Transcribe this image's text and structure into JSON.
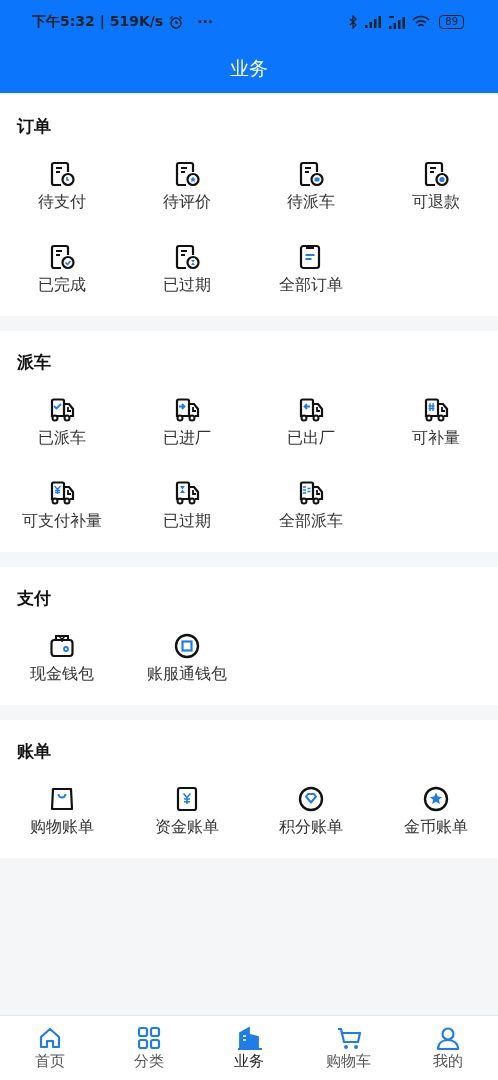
{
  "status_bar": {
    "time": "下午5:32 | 519K/s",
    "more": "···",
    "battery": "89"
  },
  "title": "业务",
  "sections": [
    {
      "title": "订单",
      "kind": "order",
      "items": [
        "待支付",
        "待评价",
        "待派车",
        "可退款",
        "已完成",
        "已过期",
        "全部订单"
      ]
    },
    {
      "title": "派车",
      "kind": "truck",
      "items": [
        "已派车",
        "已进厂",
        "已出厂",
        "可补量",
        "可支付补量",
        "已过期",
        "全部派车"
      ]
    },
    {
      "title": "支付",
      "kind": "wallet",
      "items": [
        "现金钱包",
        "账服通钱包"
      ]
    },
    {
      "title": "账单",
      "kind": "bill",
      "items": [
        "购物账单",
        "资金账单",
        "积分账单",
        "金币账单"
      ]
    }
  ],
  "tab_bar": [
    {
      "label": "首页",
      "selected": false
    },
    {
      "label": "分类",
      "selected": false
    },
    {
      "label": "业务",
      "selected": true
    },
    {
      "label": "购物车",
      "selected": false
    },
    {
      "label": "我的",
      "selected": false
    }
  ]
}
